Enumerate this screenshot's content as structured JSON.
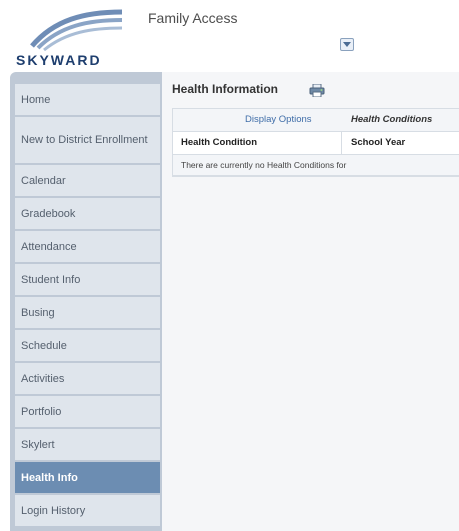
{
  "header": {
    "logo_text": "SKYWARD",
    "app_title": "Family Access"
  },
  "sidebar": {
    "items": [
      {
        "label": "Home"
      },
      {
        "label": "New to District Enrollment"
      },
      {
        "label": "Calendar"
      },
      {
        "label": "Gradebook"
      },
      {
        "label": "Attendance"
      },
      {
        "label": "Student Info"
      },
      {
        "label": "Busing"
      },
      {
        "label": "Schedule"
      },
      {
        "label": "Activities"
      },
      {
        "label": "Portfolio"
      },
      {
        "label": "Skylert"
      },
      {
        "label": "Health Info",
        "active": true
      },
      {
        "label": "Login History"
      }
    ]
  },
  "main": {
    "title": "Health Information",
    "display_options": "Display Options",
    "health_conditions_link": "Health Conditions",
    "columns": [
      "Health Condition",
      "School Year"
    ],
    "empty_message": "There are currently no Health Conditions for"
  },
  "icons": {
    "printer": "printer-icon",
    "dropdown": "chevron-down-icon"
  },
  "colors": {
    "sidebar_bg": "#bfc9d6",
    "nav_item": "#dfe5ec",
    "nav_active": "#6c8db2",
    "link": "#3f6da8"
  }
}
